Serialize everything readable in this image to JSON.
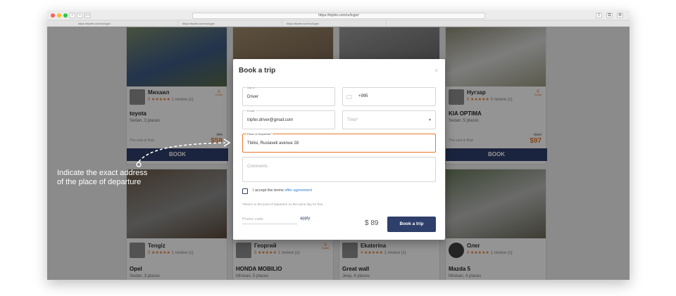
{
  "browser": {
    "url": "https://tripfer.com/ru/login/",
    "tabs": [
      "https://tripfer.com/ru/login/",
      "https://tripfer.com/ru/login/",
      "https://tripfer.com/ru/login/"
    ]
  },
  "cards": [
    {
      "driver": "Михаил",
      "rating": "5",
      "reviews": "1 review (s)",
      "guide": "Guide",
      "car": "toyota",
      "car_desc": "Sedan, 3 places",
      "fixed": "The cost is final",
      "old_price": "$69",
      "price": "$59",
      "book": "BOOK"
    },
    {
      "driver": "Нугзар",
      "rating": "0",
      "reviews": "0 review (s)",
      "guide": "Guide",
      "car": "KIA OPTIMA",
      "car_desc": "Sedan, 5 places",
      "fixed": "The cost is final",
      "old_price": "$113",
      "price": "$97",
      "book": "BOOK"
    },
    {
      "driver": "Tengiz",
      "rating": "5",
      "reviews": "1 review (s)",
      "car": "Opel",
      "car_desc": "Sedan, 3 places"
    },
    {
      "driver": "Георгий",
      "rating": "5",
      "reviews": "1 review (s)",
      "guide": "Guide",
      "car": "HONDA MOBILIO",
      "car_desc": "Minivan, 5 places"
    },
    {
      "driver": "Ekaterina",
      "rating": "4",
      "reviews": "1 review (s)",
      "car": "Great wall",
      "car_desc": "Jeep, 4 places"
    },
    {
      "driver": "Олег",
      "rating": "4",
      "reviews": "1 review (s)",
      "car": "Mazda 5",
      "car_desc": "Minivan, 4 places"
    }
  ],
  "modal": {
    "title": "Book a trip",
    "close": "×",
    "name_label": "Name*",
    "name_value": "Driver",
    "phone_value": "+995",
    "email_label": "Email*",
    "email_value": "tripfer.driver@gmail.com",
    "time_placeholder": "Time*",
    "departure_label": "Place of Departure*",
    "departure_value": "Tbilisi, Rustaveli avenue 28",
    "comments_placeholder": "Comments",
    "terms_text": "I accept the terms",
    "terms_link": "offer agreement",
    "note": "*Return to the point of departure on the same day for free",
    "promo_placeholder": "Promo code",
    "apply": "apply",
    "total": "$ 89",
    "submit": "Book a trip"
  },
  "callout": {
    "line1": "Indicate the exact address",
    "line2": "of the place of departure"
  },
  "colors": {
    "accent": "#e8782c",
    "primary": "#2f3f6b",
    "link": "#2a7bd4"
  }
}
